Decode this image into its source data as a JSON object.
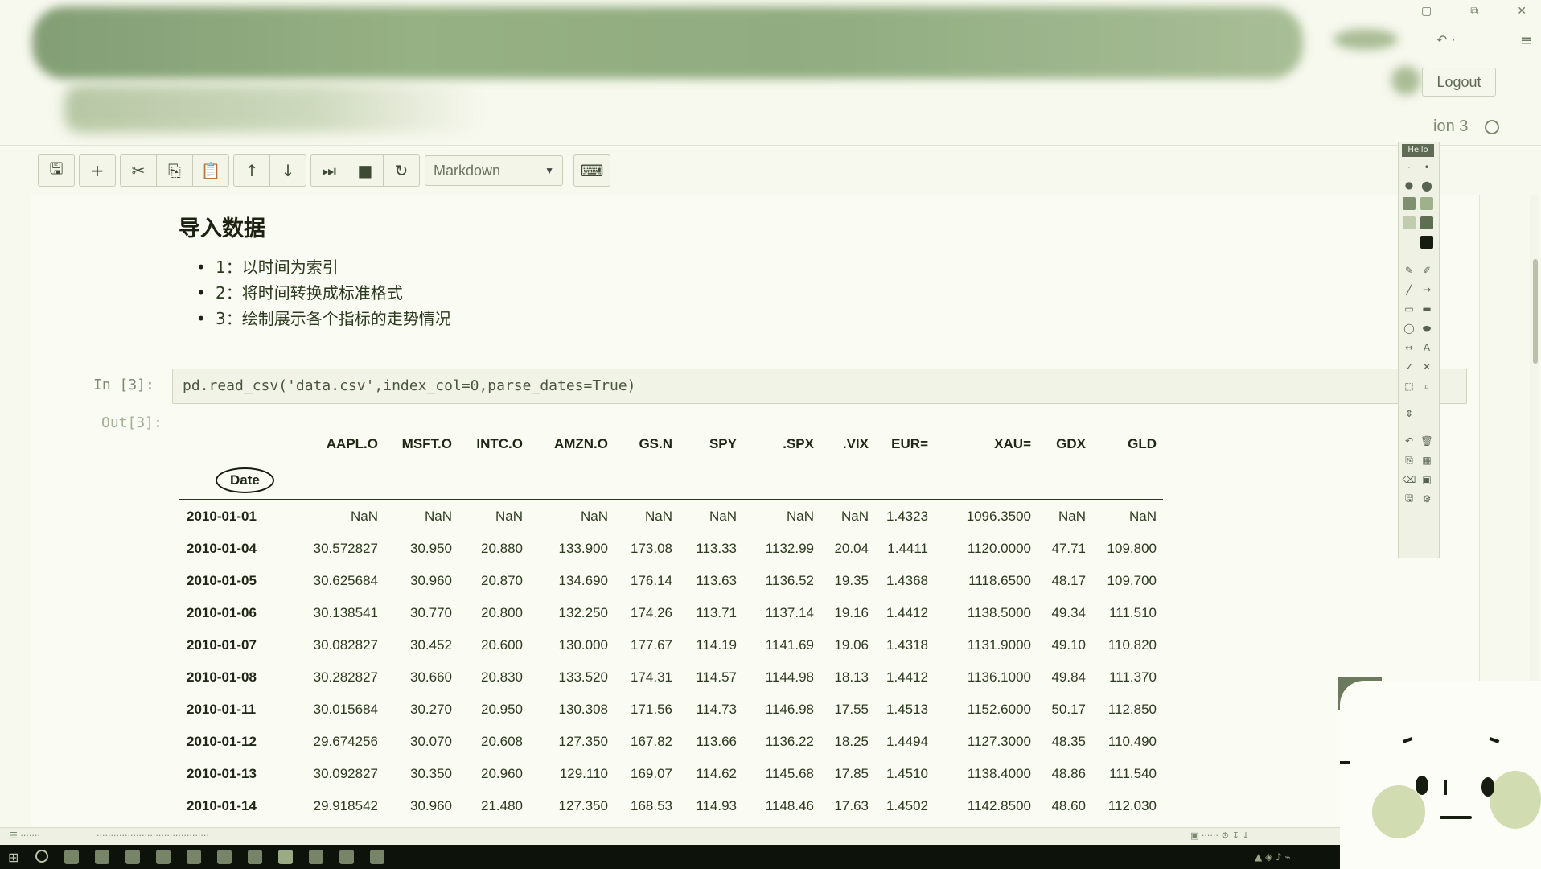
{
  "header": {
    "logout_label": "Logout",
    "kernel_label": "ion 3"
  },
  "toolbar": {
    "buttons": [
      "save-icon",
      "plus-icon",
      "cut-icon",
      "copy-icon",
      "paste-icon",
      "arrow-up-icon",
      "arrow-down-icon",
      "step-forward-icon",
      "stop-icon",
      "restart-icon",
      "keyboard-icon"
    ],
    "cell_type": "Markdown"
  },
  "markdown": {
    "title": "导入数据",
    "items": [
      "1：以时间为索引",
      "2：将时间转换成标准格式",
      "3：绘制展示各个指标的走势情况"
    ]
  },
  "cell": {
    "in_prompt": "In  [3]:",
    "code": "pd.read_csv('data.csv',index_col=0,parse_dates=True)",
    "out_prompt": "Out[3]:"
  },
  "dataframe": {
    "index_name": "Date",
    "columns": [
      "AAPL.O",
      "MSFT.O",
      "INTC.O",
      "AMZN.O",
      "GS.N",
      "SPY",
      ".SPX",
      ".VIX",
      "EUR=",
      "XAU=",
      "GDX",
      "GLD"
    ],
    "rows": [
      {
        "date": "2010-01-01",
        "values": [
          "NaN",
          "NaN",
          "NaN",
          "NaN",
          "NaN",
          "NaN",
          "NaN",
          "NaN",
          "1.4323",
          "1096.3500",
          "NaN",
          "NaN"
        ]
      },
      {
        "date": "2010-01-04",
        "values": [
          "30.572827",
          "30.950",
          "20.880",
          "133.900",
          "173.08",
          "113.33",
          "1132.99",
          "20.04",
          "1.4411",
          "1120.0000",
          "47.71",
          "109.800"
        ]
      },
      {
        "date": "2010-01-05",
        "values": [
          "30.625684",
          "30.960",
          "20.870",
          "134.690",
          "176.14",
          "113.63",
          "1136.52",
          "19.35",
          "1.4368",
          "1118.6500",
          "48.17",
          "109.700"
        ]
      },
      {
        "date": "2010-01-06",
        "values": [
          "30.138541",
          "30.770",
          "20.800",
          "132.250",
          "174.26",
          "113.71",
          "1137.14",
          "19.16",
          "1.4412",
          "1138.5000",
          "49.34",
          "111.510"
        ]
      },
      {
        "date": "2010-01-07",
        "values": [
          "30.082827",
          "30.452",
          "20.600",
          "130.000",
          "177.67",
          "114.19",
          "1141.69",
          "19.06",
          "1.4318",
          "1131.9000",
          "49.10",
          "110.820"
        ]
      },
      {
        "date": "2010-01-08",
        "values": [
          "30.282827",
          "30.660",
          "20.830",
          "133.520",
          "174.31",
          "114.57",
          "1144.98",
          "18.13",
          "1.4412",
          "1136.1000",
          "49.84",
          "111.370"
        ]
      },
      {
        "date": "2010-01-11",
        "values": [
          "30.015684",
          "30.270",
          "20.950",
          "130.308",
          "171.56",
          "114.73",
          "1146.98",
          "17.55",
          "1.4513",
          "1152.6000",
          "50.17",
          "112.850"
        ]
      },
      {
        "date": "2010-01-12",
        "values": [
          "29.674256",
          "30.070",
          "20.608",
          "127.350",
          "167.82",
          "113.66",
          "1136.22",
          "18.25",
          "1.4494",
          "1127.3000",
          "48.35",
          "110.490"
        ]
      },
      {
        "date": "2010-01-13",
        "values": [
          "30.092827",
          "30.350",
          "20.960",
          "129.110",
          "169.07",
          "114.62",
          "1145.68",
          "17.85",
          "1.4510",
          "1138.4000",
          "48.86",
          "111.540"
        ]
      },
      {
        "date": "2010-01-14",
        "values": [
          "29.918542",
          "30.960",
          "21.480",
          "127.350",
          "168.53",
          "114.93",
          "1148.46",
          "17.63",
          "1.4502",
          "1142.8500",
          "48.60",
          "112.030"
        ]
      }
    ]
  },
  "draw_panel": {
    "label": "Hello",
    "colors": [
      "#7f9070",
      "#9fb08c",
      "#c0ccae",
      "#5f6e52",
      "#161c10"
    ]
  }
}
